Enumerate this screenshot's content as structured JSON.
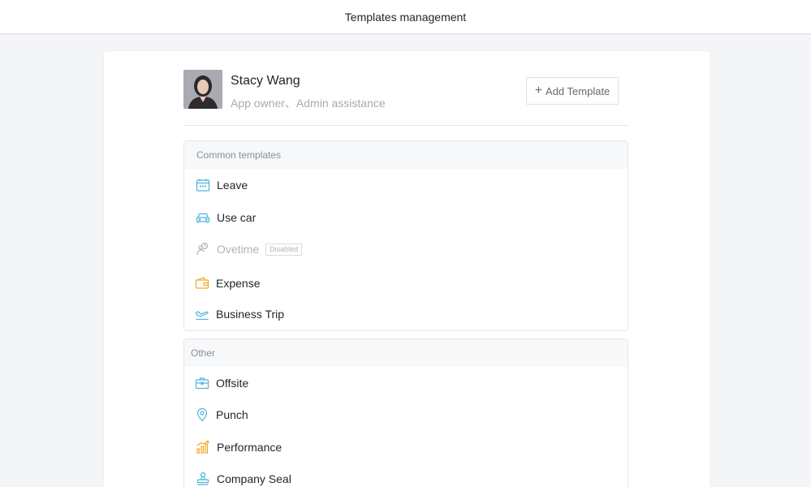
{
  "header": {
    "title": "Templates management"
  },
  "user": {
    "name": "Stacy Wang",
    "role": "App owner、Admin assistance"
  },
  "actions": {
    "add_template_label": "Add Template"
  },
  "groups": [
    {
      "title": "Common templates",
      "items": [
        {
          "label": "Leave",
          "icon": "calendar-icon",
          "disabled": false
        },
        {
          "label": "Use car",
          "icon": "car-icon",
          "disabled": false
        },
        {
          "label": "Ovetime",
          "icon": "person-clock-icon",
          "disabled": true,
          "badge": "Disabled"
        },
        {
          "label": "Expense",
          "icon": "wallet-icon",
          "disabled": false
        },
        {
          "label": "Business Trip",
          "icon": "airplane-icon",
          "disabled": false
        }
      ]
    },
    {
      "title": "Other",
      "items": [
        {
          "label": "Offsite",
          "icon": "briefcase-icon",
          "disabled": false
        },
        {
          "label": "Punch",
          "icon": "location-pin-icon",
          "disabled": false
        },
        {
          "label": "Performance",
          "icon": "bar-chart-icon",
          "disabled": false
        },
        {
          "label": "Company Seal",
          "icon": "seal-stamp-icon",
          "disabled": false
        }
      ]
    }
  ],
  "colors": {
    "accent_blue": "#4fb3d9",
    "accent_orange": "#f5a623",
    "disabled_gray": "#b0b3b9"
  }
}
